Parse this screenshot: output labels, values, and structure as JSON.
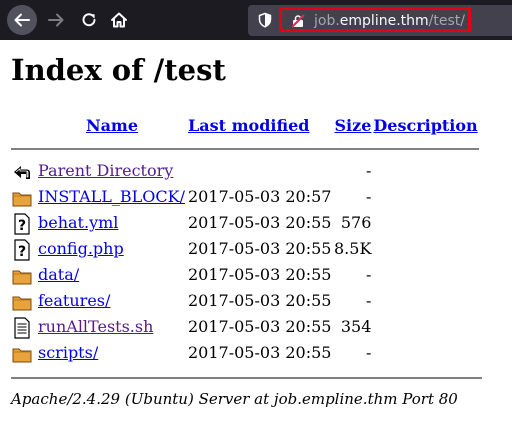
{
  "browser": {
    "url": {
      "prefix": "job.",
      "host": "empline.thm",
      "path": "/test/"
    }
  },
  "page": {
    "title": "Index of /test",
    "columns": {
      "name": "Name",
      "last_modified": "Last modified",
      "size": "Size",
      "description": "Description"
    },
    "rows": [
      {
        "icon": "back-icon",
        "name": "Parent Directory",
        "modified": "",
        "size": "-",
        "visited": true
      },
      {
        "icon": "folder-icon",
        "name": "INSTALL_BLOCK/",
        "modified": "2017-05-03 20:57",
        "size": "-",
        "visited": false
      },
      {
        "icon": "unknown-file-icon",
        "name": "behat.yml",
        "modified": "2017-05-03 20:55",
        "size": "576",
        "visited": false
      },
      {
        "icon": "unknown-file-icon",
        "name": "config.php",
        "modified": "2017-05-03 20:55",
        "size": "8.5K",
        "visited": false
      },
      {
        "icon": "folder-icon",
        "name": "data/",
        "modified": "2017-05-03 20:55",
        "size": "-",
        "visited": false
      },
      {
        "icon": "folder-icon",
        "name": "features/",
        "modified": "2017-05-03 20:55",
        "size": "-",
        "visited": false
      },
      {
        "icon": "text-file-icon",
        "name": "runAllTests.sh",
        "modified": "2017-05-03 20:55",
        "size": "354",
        "visited": true
      },
      {
        "icon": "folder-icon",
        "name": "scripts/",
        "modified": "2017-05-03 20:55",
        "size": "-",
        "visited": false
      }
    ],
    "footer": "Apache/2.4.29 (Ubuntu) Server at job.empline.thm Port 80"
  },
  "colors": {
    "toolbar": "#1c1b22",
    "urlbar": "#42414d",
    "url_highlight": "#e3001b",
    "link": "#0000ee",
    "visited_link": "#551a8b"
  }
}
